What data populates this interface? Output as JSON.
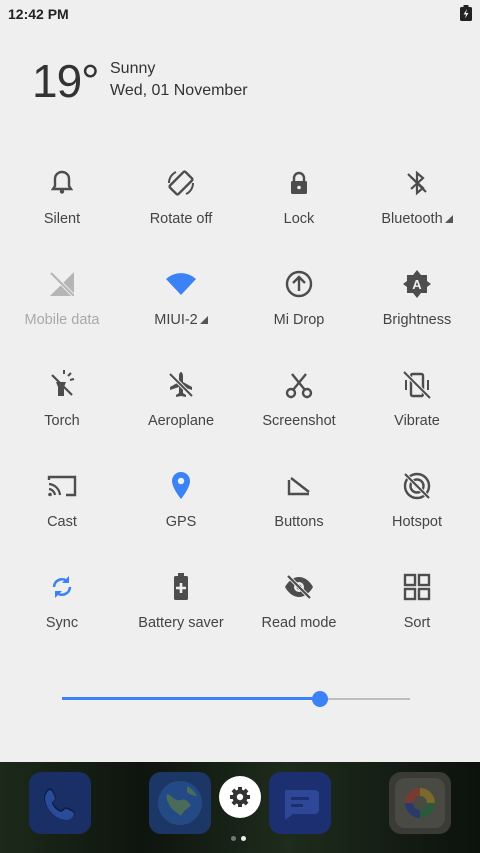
{
  "status_bar": {
    "time": "12:42 PM"
  },
  "weather": {
    "temperature": "19°",
    "condition": "Sunny",
    "date": "Wed, 01 November"
  },
  "tiles": [
    {
      "label": "Silent",
      "icon": "bell-icon",
      "active": false
    },
    {
      "label": "Rotate off",
      "icon": "rotate-icon",
      "active": false
    },
    {
      "label": "Lock",
      "icon": "lock-icon",
      "active": false
    },
    {
      "label": "Bluetooth",
      "icon": "bluetooth-icon",
      "active": false
    },
    {
      "label": "Mobile data",
      "icon": "mobile-data-icon",
      "active": false
    },
    {
      "label": "MIUI-2",
      "icon": "wifi-icon",
      "active": true
    },
    {
      "label": "Mi Drop",
      "icon": "mi-drop-icon",
      "active": false
    },
    {
      "label": "Brightness",
      "icon": "brightness-icon",
      "active": false
    },
    {
      "label": "Torch",
      "icon": "torch-icon",
      "active": false
    },
    {
      "label": "Aeroplane",
      "icon": "airplane-icon",
      "active": false
    },
    {
      "label": "Screenshot",
      "icon": "scissors-icon",
      "active": false
    },
    {
      "label": "Vibrate",
      "icon": "vibrate-icon",
      "active": false
    },
    {
      "label": "Cast",
      "icon": "cast-icon",
      "active": false
    },
    {
      "label": "GPS",
      "icon": "location-pin-icon",
      "active": true
    },
    {
      "label": "Buttons",
      "icon": "buttons-icon",
      "active": false
    },
    {
      "label": "Hotspot",
      "icon": "hotspot-icon",
      "active": false
    },
    {
      "label": "Sync",
      "icon": "sync-icon",
      "active": true
    },
    {
      "label": "Battery saver",
      "icon": "battery-saver-icon",
      "active": false
    },
    {
      "label": "Read mode",
      "icon": "eye-icon",
      "active": false
    },
    {
      "label": "Sort",
      "icon": "grid-icon",
      "active": false
    }
  ],
  "brightness": {
    "level": 0.74
  },
  "dock": {
    "apps": [
      "phone-icon",
      "browser-icon",
      "messages-icon",
      "camera-icon"
    ],
    "settings_icon": "gear-icon",
    "page_count": 2,
    "current_page": 1
  },
  "colors": {
    "accent": "#3b82f6",
    "panel": "#efefef",
    "icon": "#4d4d4d",
    "disabled": "#b5b5b5"
  }
}
